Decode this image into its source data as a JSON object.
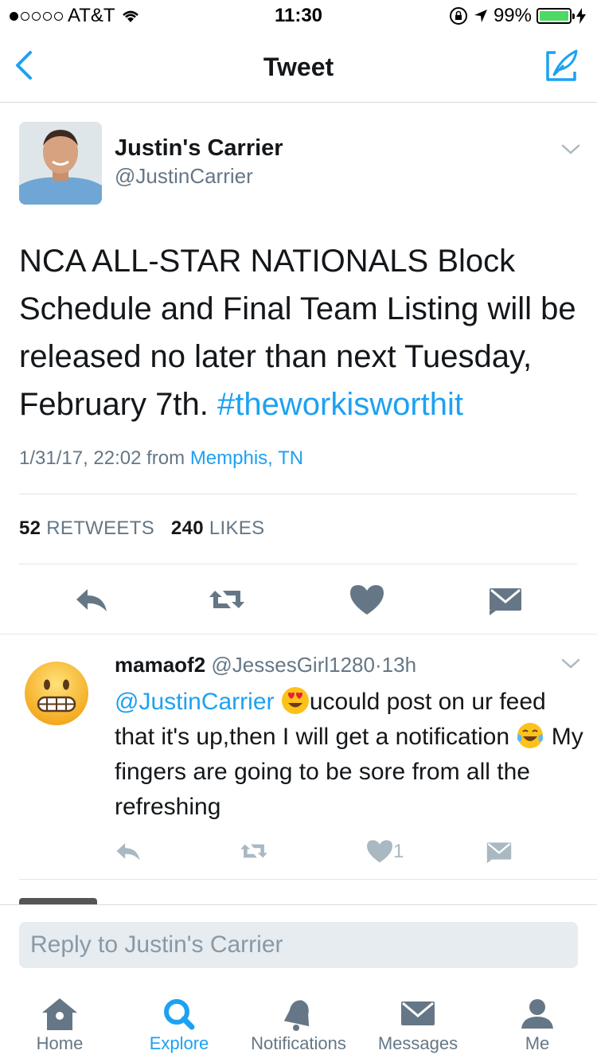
{
  "status_bar": {
    "carrier": "AT&T",
    "time": "11:30",
    "battery": "99%",
    "signal_bars": 1,
    "battery_level": 0.99
  },
  "nav": {
    "title": "Tweet",
    "back_icon": "chevron-left-icon",
    "compose_icon": "compose-tweet-icon"
  },
  "tweet": {
    "author_name": "Justin's Carrier",
    "author_handle": "@JustinCarrier",
    "text": "NCA ALL-STAR NATIONALS Block Schedule and Final Team Listing will be released no later than next Tuesday, February 7th.",
    "hashtag": "#theworkisworthit",
    "timestamp": "1/31/17, 22:02",
    "from_label": "from",
    "location": "Memphis, TN",
    "retweets_count": "52",
    "retweets_label": "RETWEETS",
    "likes_count": "240",
    "likes_label": "LIKES"
  },
  "reply": {
    "name": "mamaof2",
    "handle": "@JessesGirl1280",
    "separator": "·",
    "time": "13h",
    "mention": "@JustinCarrier",
    "text_part1": "ucould post on ur feed that it's up,then I will get a notification",
    "text_part2": "My fingers are going to be sore from all the refreshing",
    "like_count": "1"
  },
  "reply_box": {
    "placeholder": "Reply to Justin's Carrier"
  },
  "tabs": [
    {
      "label": "Home",
      "icon": "home-icon",
      "active": false
    },
    {
      "label": "Explore",
      "icon": "search-icon",
      "active": true
    },
    {
      "label": "Notifications",
      "icon": "bell-icon",
      "active": false
    },
    {
      "label": "Messages",
      "icon": "envelope-icon",
      "active": false
    },
    {
      "label": "Me",
      "icon": "person-icon",
      "active": false
    }
  ],
  "colors": {
    "accent": "#1da1f2",
    "text": "#14171a",
    "secondary": "#657786",
    "action_gray": "#657786",
    "battery_green": "#4cd964"
  }
}
